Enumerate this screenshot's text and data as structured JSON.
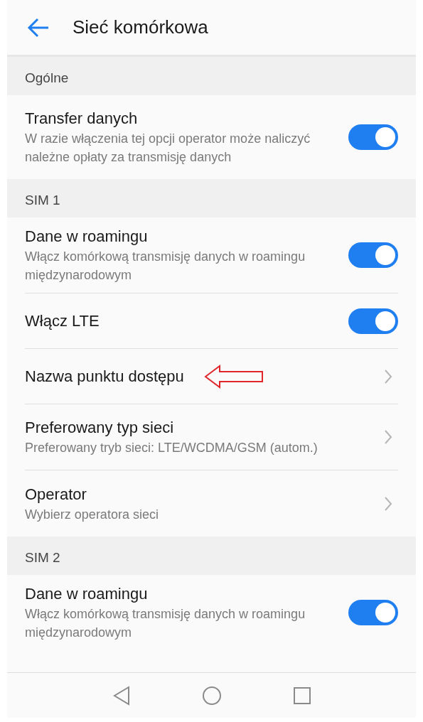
{
  "header": {
    "title": "Sieć komórkowa"
  },
  "sections": [
    {
      "title": "Ogólne",
      "items": [
        {
          "kind": "toggle",
          "title": "Transfer danych",
          "subtitle": "W razie włączenia tej opcji operator może naliczyć należne opłaty za transmisję danych",
          "on": true,
          "annotated": false
        }
      ]
    },
    {
      "title": "SIM 1",
      "items": [
        {
          "kind": "toggle",
          "title": "Dane w roamingu",
          "subtitle": "Włącz komórkową transmisję danych w roamingu międzynarodowym",
          "on": true,
          "annotated": false
        },
        {
          "kind": "toggle",
          "title": "Włącz LTE",
          "on": true,
          "annotated": false
        },
        {
          "kind": "link",
          "title": "Nazwa punktu dostępu",
          "annotated": true
        },
        {
          "kind": "link",
          "title": "Preferowany typ sieci",
          "subtitle": "Preferowany tryb sieci: LTE/WCDMA/GSM (autom.)",
          "annotated": false
        },
        {
          "kind": "link",
          "title": "Operator",
          "subtitle": "Wybierz operatora sieci",
          "annotated": false
        }
      ]
    },
    {
      "title": "SIM 2",
      "items": [
        {
          "kind": "toggle",
          "title": "Dane w roamingu",
          "subtitle": "Włącz komórkową transmisję danych w roamingu międzynarodowym",
          "on": true,
          "annotated": false
        }
      ]
    }
  ]
}
